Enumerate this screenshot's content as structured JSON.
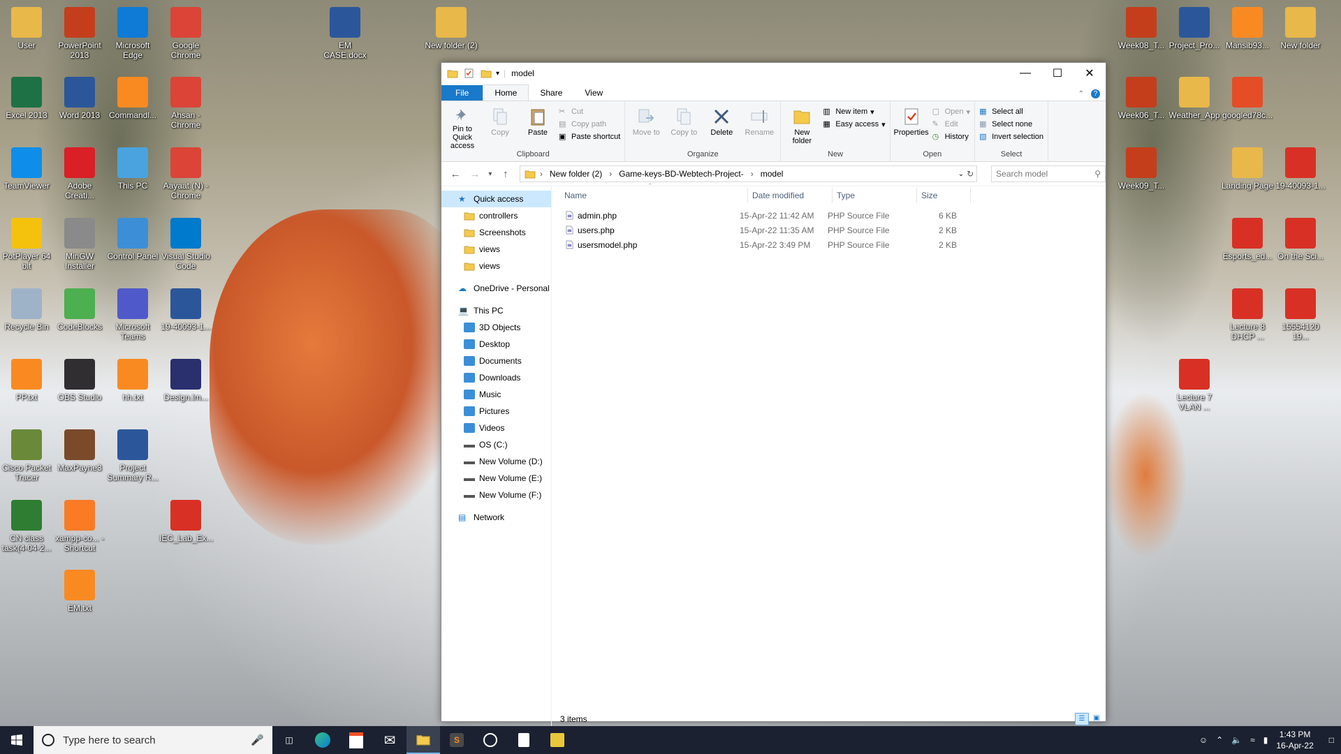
{
  "desktop": {
    "left_icons": [
      {
        "label": "User",
        "icon": "user-folder-icon",
        "color": "#e8b84a"
      },
      {
        "label": "PowerPoint 2013",
        "icon": "powerpoint-icon",
        "color": "#c43e1c"
      },
      {
        "label": "Microsoft Edge",
        "icon": "edge-icon",
        "color": "#0f7bd6"
      },
      {
        "label": "Google Chrome",
        "icon": "chrome-icon",
        "color": "#db4437"
      },
      {
        "label": "Excel 2013",
        "icon": "excel-icon",
        "color": "#1e7145"
      },
      {
        "label": "Word 2013",
        "icon": "word-icon",
        "color": "#2b579a"
      },
      {
        "label": "Commandl...",
        "icon": "sublime-icon",
        "color": "#f98a22"
      },
      {
        "label": "Ahsan - Chrome",
        "icon": "chrome-icon",
        "color": "#db4437"
      },
      {
        "label": "TeamViewer",
        "icon": "teamviewer-icon",
        "color": "#0e8ee9"
      },
      {
        "label": "Adobe Creati...",
        "icon": "adobe-icon",
        "color": "#da1f26"
      },
      {
        "label": "This PC",
        "icon": "this-pc-icon",
        "color": "#4aa3df"
      },
      {
        "label": "Aayaat (N) - Chrome",
        "icon": "chrome-icon",
        "color": "#db4437"
      },
      {
        "label": "PotPlayer 64 bit",
        "icon": "potplayer-icon",
        "color": "#f4c20d"
      },
      {
        "label": "MinGW Installer",
        "icon": "mingw-icon",
        "color": "#8a8a8a"
      },
      {
        "label": "Control Panel",
        "icon": "control-panel-icon",
        "color": "#3c8fd6"
      },
      {
        "label": "Visual Studio Code",
        "icon": "vscode-icon",
        "color": "#007acc"
      },
      {
        "label": "Recycle Bin",
        "icon": "recycle-bin-icon",
        "color": "#9fb3c8"
      },
      {
        "label": "CodeBlocks",
        "icon": "codeblocks-icon",
        "color": "#4caf50"
      },
      {
        "label": "Microsoft Teams",
        "icon": "teams-icon",
        "color": "#5059c9"
      },
      {
        "label": "19-40093-1...",
        "icon": "word-doc-icon",
        "color": "#2b579a"
      },
      {
        "label": "PP.txt",
        "icon": "sublime-icon",
        "color": "#f98a22"
      },
      {
        "label": "OBS Studio",
        "icon": "obs-icon",
        "color": "#302e31"
      },
      {
        "label": "hh.txt",
        "icon": "sublime-icon",
        "color": "#f98a22"
      },
      {
        "label": "Design.lm...",
        "icon": "design-icon",
        "color": "#2a2f6e"
      },
      {
        "label": "Cisco Packet Tracer",
        "icon": "cisco-icon",
        "color": "#6a8a3a"
      },
      {
        "label": "MaxPayne3",
        "icon": "maxpayne-icon",
        "color": "#7a4a2a"
      },
      {
        "label": "Project Summary R...",
        "icon": "word-doc-icon",
        "color": "#2b579a"
      },
      {
        "label": "CN class task(4-04-2...",
        "icon": "cn-task-icon",
        "color": "#2e7d32"
      },
      {
        "label": "xampp-co... - Shortcut",
        "icon": "xampp-icon",
        "color": "#fb7a24"
      },
      {
        "label": "IEC_Lab_Ex...",
        "icon": "pdf-icon",
        "color": "#d93025"
      },
      {
        "label": "EM.txt",
        "icon": "sublime-icon",
        "color": "#f98a22"
      },
      {
        "label": "EM CASE.docx",
        "icon": "word-doc-icon",
        "color": "#2b579a"
      },
      {
        "label": "New folder (2)",
        "icon": "folder-icon",
        "color": "#e8b84a"
      }
    ],
    "right_icons": [
      {
        "label": "Week08_T...",
        "icon": "ppt-thumb-icon",
        "color": "#c43e1c"
      },
      {
        "label": "Project_Pro...",
        "icon": "word-doc-icon",
        "color": "#2b579a"
      },
      {
        "label": "Mansib93...",
        "icon": "sublime-icon",
        "color": "#f98a22"
      },
      {
        "label": "New folder",
        "icon": "folder-icon",
        "color": "#e8b84a"
      },
      {
        "label": "Week06_T...",
        "icon": "ppt-thumb-icon",
        "color": "#c43e1c"
      },
      {
        "label": "Weather_App",
        "icon": "folder-icon",
        "color": "#e8b84a"
      },
      {
        "label": "googled78c...",
        "icon": "html-icon",
        "color": "#e44d26"
      },
      {
        "label": "Week09_T...",
        "icon": "ppt-thumb-icon",
        "color": "#c43e1c"
      },
      {
        "label": "Landing Page",
        "icon": "chrome-folder-icon",
        "color": "#e8b84a"
      },
      {
        "label": "19-40093-1...",
        "icon": "pdf-icon",
        "color": "#d93025"
      },
      {
        "label": "Esports_ed...",
        "icon": "pdf-icon",
        "color": "#d93025"
      },
      {
        "label": "On the Sci...",
        "icon": "pdf-icon",
        "color": "#d93025"
      },
      {
        "label": "Lecture 8 DHCP ...",
        "icon": "pdf-icon",
        "color": "#d93025"
      },
      {
        "label": "15554120 19...",
        "icon": "pdf-icon",
        "color": "#d93025"
      },
      {
        "label": "Lecture 7 VLAN ...",
        "icon": "pdf-icon",
        "color": "#d93025"
      }
    ]
  },
  "explorer": {
    "title": "model",
    "tabs": {
      "file": "File",
      "home": "Home",
      "share": "Share",
      "view": "View"
    },
    "ribbon": {
      "clipboard": {
        "name": "Clipboard",
        "pin": "Pin to Quick access",
        "copy": "Copy",
        "paste": "Paste",
        "cut": "Cut",
        "copy_path": "Copy path",
        "paste_shortcut": "Paste shortcut"
      },
      "organize": {
        "name": "Organize",
        "move_to": "Move to",
        "copy_to": "Copy to",
        "delete": "Delete",
        "rename": "Rename"
      },
      "new": {
        "name": "New",
        "new_folder": "New folder",
        "new_item": "New item",
        "easy_access": "Easy access"
      },
      "open": {
        "name": "Open",
        "properties": "Properties",
        "open": "Open",
        "edit": "Edit",
        "history": "History"
      },
      "select": {
        "name": "Select",
        "select_all": "Select all",
        "select_none": "Select none",
        "invert": "Invert selection"
      }
    },
    "address": {
      "crumbs": [
        "New folder (2)",
        "Game-keys-BD-Webtech-Project-",
        "model"
      ],
      "search_placeholder": "Search model"
    },
    "nav": {
      "quick_access": "Quick access",
      "quick_items": [
        "controllers",
        "Screenshots",
        "views",
        "views"
      ],
      "onedrive": "OneDrive - Personal",
      "this_pc": "This PC",
      "pc_items": [
        "3D Objects",
        "Desktop",
        "Documents",
        "Downloads",
        "Music",
        "Pictures",
        "Videos",
        "OS (C:)",
        "New Volume (D:)",
        "New Volume (E:)",
        "New Volume (F:)"
      ],
      "network": "Network"
    },
    "columns": {
      "name": "Name",
      "date": "Date modified",
      "type": "Type",
      "size": "Size"
    },
    "files": [
      {
        "name": "admin.php",
        "date": "15-Apr-22 11:42 AM",
        "type": "PHP Source File",
        "size": "6 KB"
      },
      {
        "name": "users.php",
        "date": "15-Apr-22 11:35 AM",
        "type": "PHP Source File",
        "size": "2 KB"
      },
      {
        "name": "usersmodel.php",
        "date": "15-Apr-22 3:49 PM",
        "type": "PHP Source File",
        "size": "2 KB"
      }
    ],
    "status": "3 items"
  },
  "taskbar": {
    "search_placeholder": "Type here to search",
    "time": "1:43 PM",
    "date": "16-Apr-22"
  }
}
